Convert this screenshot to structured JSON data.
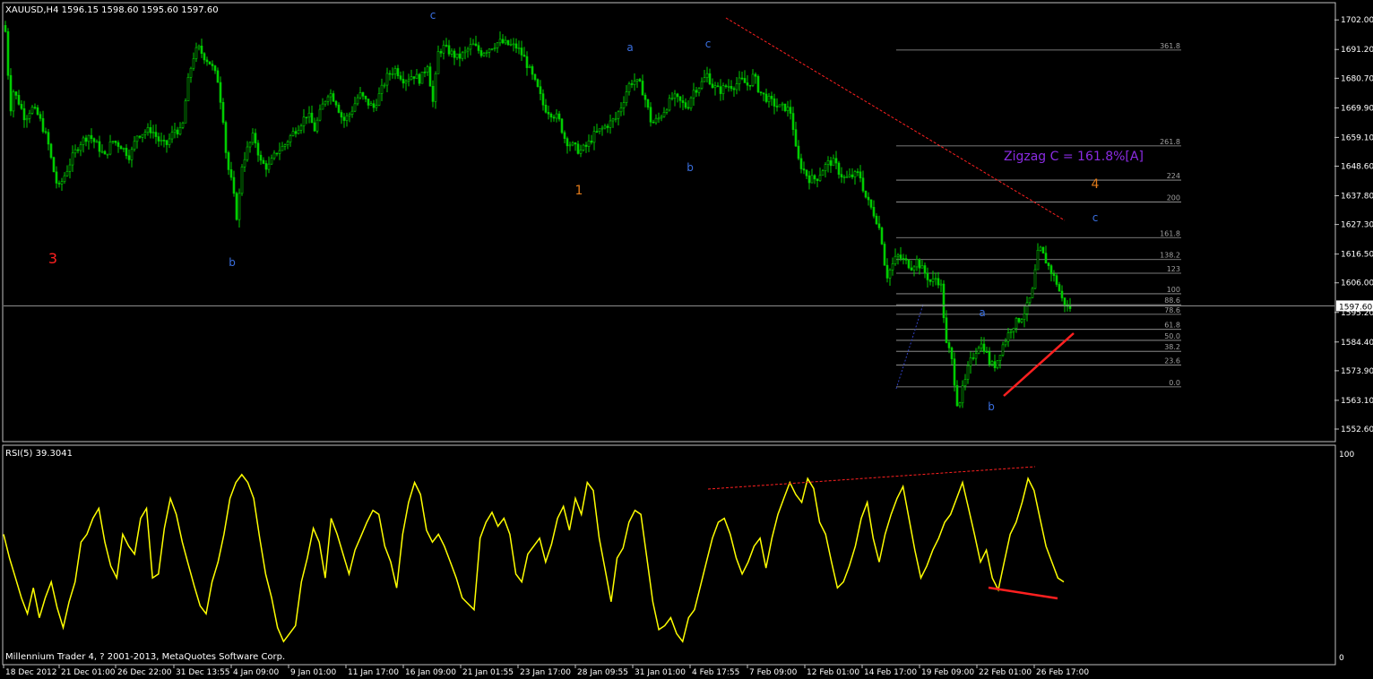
{
  "main_header": "XAUUSD,H4  1596.15 1598.60 1595.60 1597.60",
  "rsi_header": "RSI(5) 39.3041",
  "copyright": "Millennium Trader 4, ? 2001-2013, MetaQuotes Software Corp.",
  "price_tag": "1597.60",
  "zigzag_label": "Zigzag  C = 161.8%[A]",
  "colors": {
    "background": "#000000",
    "bull_candle": "#00cc00",
    "bear_candle": "#00cc00",
    "rsi_line": "#ffff00",
    "fib_lines": "#a0a0a0",
    "trendline": "#ff2020",
    "wave_blue": "#3a6fe0",
    "wave_orange": "#e07a1a",
    "wave_red": "#ff2020",
    "zigzag_label": "#8a2be2",
    "axis_text": "#ffffff",
    "frame": "#c0c0c0"
  },
  "chart_data": {
    "type": "candlestick",
    "symbol": "XAUUSD",
    "timeframe": "H4",
    "ohlc_last": {
      "open": 1596.15,
      "high": 1598.6,
      "low": 1595.6,
      "close": 1597.6
    },
    "ylim": [
      1549.0,
      1706.0
    ],
    "y_ticks": [
      "1702.00",
      "1691.20",
      "1680.70",
      "1669.90",
      "1659.10",
      "1648.60",
      "1637.80",
      "1627.30",
      "1616.50",
      "1606.00",
      "1595.20",
      "1584.40",
      "1573.90",
      "1563.10",
      "1552.60"
    ],
    "x_ticks": [
      "18 Dec 2012",
      "21 Dec 01:00",
      "26 Dec 22:00",
      "31 Dec 13:55",
      "4 Jan 09:00",
      "9 Jan 01:00",
      "11 Jan 17:00",
      "16 Jan 09:00",
      "21 Jan 01:55",
      "23 Jan 17:00",
      "28 Jan 09:55",
      "31 Jan 01:00",
      "4 Feb 17:55",
      "7 Feb 09:00",
      "12 Feb 01:00",
      "14 Feb 17:00",
      "19 Feb 09:00",
      "22 Feb 01:00",
      "26 Feb 17:00"
    ],
    "price_path": [
      [
        0,
        1700
      ],
      [
        4,
        1697
      ],
      [
        8,
        1668
      ],
      [
        12,
        1676
      ],
      [
        18,
        1672
      ],
      [
        25,
        1666
      ],
      [
        32,
        1670
      ],
      [
        40,
        1667
      ],
      [
        50,
        1658
      ],
      [
        56,
        1648
      ],
      [
        62,
        1640
      ],
      [
        70,
        1646
      ],
      [
        78,
        1652
      ],
      [
        86,
        1657
      ],
      [
        96,
        1660
      ],
      [
        106,
        1656
      ],
      [
        114,
        1652
      ],
      [
        122,
        1658
      ],
      [
        132,
        1656
      ],
      [
        142,
        1652
      ],
      [
        150,
        1660
      ],
      [
        158,
        1661
      ],
      [
        166,
        1662
      ],
      [
        174,
        1658
      ],
      [
        182,
        1656
      ],
      [
        192,
        1662
      ],
      [
        200,
        1661
      ],
      [
        206,
        1678
      ],
      [
        212,
        1688
      ],
      [
        218,
        1692
      ],
      [
        224,
        1689
      ],
      [
        232,
        1686
      ],
      [
        240,
        1680
      ],
      [
        246,
        1666
      ],
      [
        250,
        1650
      ],
      [
        256,
        1642
      ],
      [
        262,
        1628
      ],
      [
        266,
        1648
      ],
      [
        272,
        1654
      ],
      [
        280,
        1660
      ],
      [
        288,
        1650
      ],
      [
        296,
        1648
      ],
      [
        306,
        1654
      ],
      [
        314,
        1656
      ],
      [
        322,
        1660
      ],
      [
        332,
        1664
      ],
      [
        340,
        1668
      ],
      [
        348,
        1662
      ],
      [
        356,
        1670
      ],
      [
        364,
        1676
      ],
      [
        372,
        1672
      ],
      [
        380,
        1665
      ],
      [
        388,
        1668
      ],
      [
        398,
        1675
      ],
      [
        406,
        1672
      ],
      [
        414,
        1670
      ],
      [
        422,
        1676
      ],
      [
        430,
        1682
      ],
      [
        438,
        1684
      ],
      [
        448,
        1680
      ],
      [
        458,
        1682
      ],
      [
        466,
        1680
      ],
      [
        474,
        1686
      ],
      [
        480,
        1672
      ],
      [
        486,
        1690
      ],
      [
        492,
        1692
      ],
      [
        500,
        1690
      ],
      [
        508,
        1688
      ],
      [
        516,
        1690
      ],
      [
        524,
        1693
      ],
      [
        534,
        1690
      ],
      [
        544,
        1692
      ],
      [
        554,
        1694
      ],
      [
        564,
        1693
      ],
      [
        574,
        1692
      ],
      [
        582,
        1688
      ],
      [
        590,
        1682
      ],
      [
        598,
        1676
      ],
      [
        604,
        1670
      ],
      [
        612,
        1668
      ],
      [
        620,
        1666
      ],
      [
        628,
        1658
      ],
      [
        636,
        1656
      ],
      [
        644,
        1654
      ],
      [
        652,
        1656
      ],
      [
        660,
        1660
      ],
      [
        668,
        1662
      ],
      [
        676,
        1664
      ],
      [
        684,
        1666
      ],
      [
        692,
        1672
      ],
      [
        698,
        1678
      ],
      [
        704,
        1680
      ],
      [
        712,
        1678
      ],
      [
        718,
        1672
      ],
      [
        724,
        1664
      ],
      [
        732,
        1666
      ],
      [
        740,
        1670
      ],
      [
        748,
        1674
      ],
      [
        756,
        1672
      ],
      [
        764,
        1670
      ],
      [
        770,
        1676
      ],
      [
        778,
        1678
      ],
      [
        786,
        1682
      ],
      [
        792,
        1678
      ],
      [
        800,
        1676
      ],
      [
        808,
        1678
      ],
      [
        816,
        1678
      ],
      [
        824,
        1680
      ],
      [
        832,
        1678
      ],
      [
        838,
        1682
      ],
      [
        844,
        1676
      ],
      [
        850,
        1674
      ],
      [
        858,
        1672
      ],
      [
        866,
        1670
      ],
      [
        874,
        1670
      ],
      [
        880,
        1668
      ],
      [
        886,
        1652
      ],
      [
        892,
        1648
      ],
      [
        900,
        1644
      ],
      [
        908,
        1644
      ],
      [
        916,
        1648
      ],
      [
        922,
        1650
      ],
      [
        928,
        1650
      ],
      [
        934,
        1646
      ],
      [
        940,
        1644
      ],
      [
        948,
        1645
      ],
      [
        956,
        1646
      ],
      [
        962,
        1638
      ],
      [
        968,
        1634
      ],
      [
        974,
        1630
      ],
      [
        980,
        1624
      ],
      [
        986,
        1608
      ],
      [
        992,
        1612
      ],
      [
        998,
        1616
      ],
      [
        1006,
        1614
      ],
      [
        1014,
        1612
      ],
      [
        1020,
        1614
      ],
      [
        1028,
        1610
      ],
      [
        1036,
        1606
      ],
      [
        1042,
        1608
      ],
      [
        1048,
        1604
      ],
      [
        1052,
        1584
      ],
      [
        1058,
        1580
      ],
      [
        1062,
        1570
      ],
      [
        1066,
        1560
      ],
      [
        1070,
        1566
      ],
      [
        1074,
        1570
      ],
      [
        1078,
        1576
      ],
      [
        1084,
        1580
      ],
      [
        1090,
        1584
      ],
      [
        1096,
        1582
      ],
      [
        1102,
        1576
      ],
      [
        1108,
        1576
      ],
      [
        1114,
        1582
      ],
      [
        1120,
        1586
      ],
      [
        1126,
        1590
      ],
      [
        1132,
        1592
      ],
      [
        1138,
        1594
      ],
      [
        1144,
        1598
      ],
      [
        1150,
        1604
      ],
      [
        1154,
        1616
      ],
      [
        1158,
        1618
      ],
      [
        1164,
        1614
      ],
      [
        1170,
        1610
      ],
      [
        1176,
        1606
      ],
      [
        1182,
        1600
      ],
      [
        1188,
        1597
      ]
    ],
    "current_price": 1597.6,
    "fibonacci": {
      "levels": [
        {
          "label": "361.8",
          "price": 1691.0
        },
        {
          "label": "261.8",
          "price": 1656.0
        },
        {
          "label": "224",
          "price": 1643.5
        },
        {
          "label": "200",
          "price": 1635.5
        },
        {
          "label": "161.8",
          "price": 1622.5
        },
        {
          "label": "138.2",
          "price": 1614.5
        },
        {
          "label": "123",
          "price": 1609.5
        },
        {
          "label": "100",
          "price": 1602.0
        },
        {
          "label": "88.6",
          "price": 1598.0
        },
        {
          "label": "78.6",
          "price": 1594.5
        },
        {
          "label": "61.8",
          "price": 1589.0
        },
        {
          "label": "50.0",
          "price": 1585.0
        },
        {
          "label": "38.2",
          "price": 1581.0
        },
        {
          "label": "23.6",
          "price": 1576.0
        },
        {
          "label": "0.0",
          "price": 1568.0
        }
      ]
    },
    "wave_labels": [
      {
        "text": "c",
        "color": "blue"
      },
      {
        "text": "3",
        "color": "red"
      },
      {
        "text": "b",
        "color": "blue"
      },
      {
        "text": "a",
        "color": "blue"
      },
      {
        "text": "c",
        "color": "blue"
      },
      {
        "text": "1",
        "color": "orange"
      },
      {
        "text": "b",
        "color": "blue"
      },
      {
        "text": "4",
        "color": "orange"
      },
      {
        "text": "c",
        "color": "blue"
      },
      {
        "text": "a",
        "color": "blue"
      },
      {
        "text": "b",
        "color": "blue"
      }
    ],
    "rsi": {
      "period": 5,
      "last_value": 39.3041,
      "ylim": [
        0,
        100
      ],
      "y_ticks": [
        "100",
        "0"
      ],
      "values": [
        62,
        50,
        40,
        30,
        22,
        35,
        20,
        30,
        38,
        25,
        15,
        28,
        38,
        58,
        62,
        70,
        75,
        58,
        46,
        40,
        62,
        56,
        52,
        70,
        75,
        40,
        42,
        65,
        80,
        72,
        58,
        47,
        36,
        26,
        22,
        38,
        48,
        62,
        80,
        88,
        92,
        88,
        80,
        60,
        42,
        30,
        15,
        8,
        12,
        16,
        38,
        50,
        65,
        58,
        40,
        70,
        62,
        52,
        42,
        54,
        61,
        68,
        74,
        72,
        56,
        48,
        35,
        62,
        78,
        88,
        82,
        64,
        58,
        62,
        56,
        48,
        40,
        30,
        27,
        24,
        60,
        68,
        73,
        66,
        70,
        62,
        42,
        38,
        52,
        56,
        60,
        48,
        57,
        70,
        76,
        64,
        80,
        72,
        88,
        84,
        60,
        44,
        28,
        50,
        55,
        68,
        74,
        72,
        50,
        28,
        14,
        16,
        20,
        12,
        8,
        20,
        24,
        36,
        48,
        60,
        68,
        70,
        62,
        50,
        42,
        48,
        56,
        60,
        45,
        60,
        72,
        80,
        88,
        82,
        78,
        90,
        85,
        68,
        62,
        48,
        35,
        38,
        46,
        56,
        70,
        78,
        60,
        48,
        62,
        72,
        80,
        86,
        70,
        54,
        40,
        46,
        54,
        60,
        68,
        72,
        80,
        88,
        75,
        62,
        48,
        54,
        40,
        34,
        48,
        62,
        68,
        78,
        90,
        84,
        70,
        56,
        48,
        40,
        38
      ]
    }
  }
}
